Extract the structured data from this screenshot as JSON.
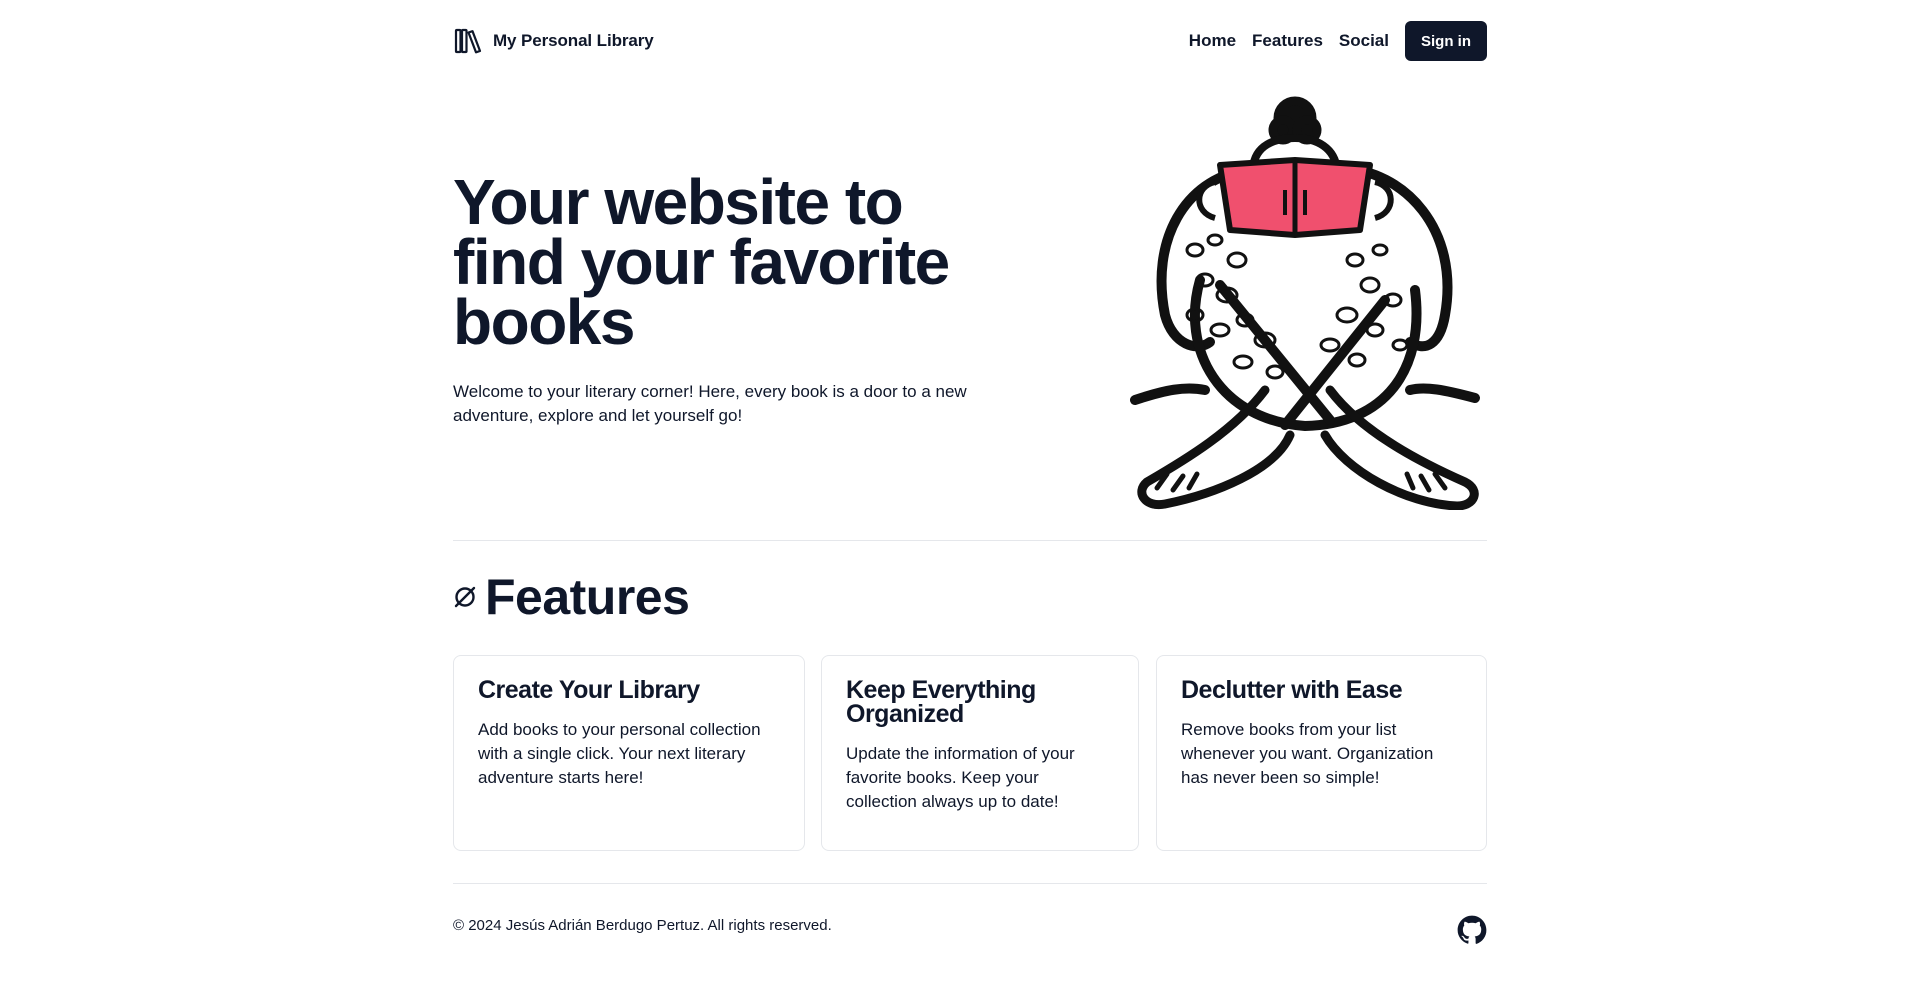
{
  "header": {
    "brand": "My Personal Library",
    "logo_icon": "library-icon",
    "nav": [
      "Home",
      "Features",
      "Social"
    ],
    "signin_label": "Sign in"
  },
  "hero": {
    "title": "Your website to find your favorite books",
    "description": "Welcome to your literary corner! Here, every book is a door to a new adventure, explore and let yourself go!",
    "illustration": "person-reading-book-illustration",
    "accent_color": "#f0506e"
  },
  "features": {
    "icon": "empty-set-icon",
    "title": "Features",
    "cards": [
      {
        "title": "Create Your Library",
        "text": "Add books to your personal collection with a single click. Your next literary adventure starts here!"
      },
      {
        "title": "Keep Everything Organized",
        "text": "Update the information of your favorite books. Keep your collection always up to date!"
      },
      {
        "title": "Declutter with Ease",
        "text": "Remove books from your list whenever you want. Organization has never been so simple!"
      }
    ]
  },
  "footer": {
    "copyright": "© 2024 Jesús Adrián Berdugo Pertuz. All rights reserved.",
    "social_icon": "github-icon"
  },
  "colors": {
    "primary": "#0f172a",
    "border": "#e5e7eb",
    "background": "#ffffff"
  }
}
